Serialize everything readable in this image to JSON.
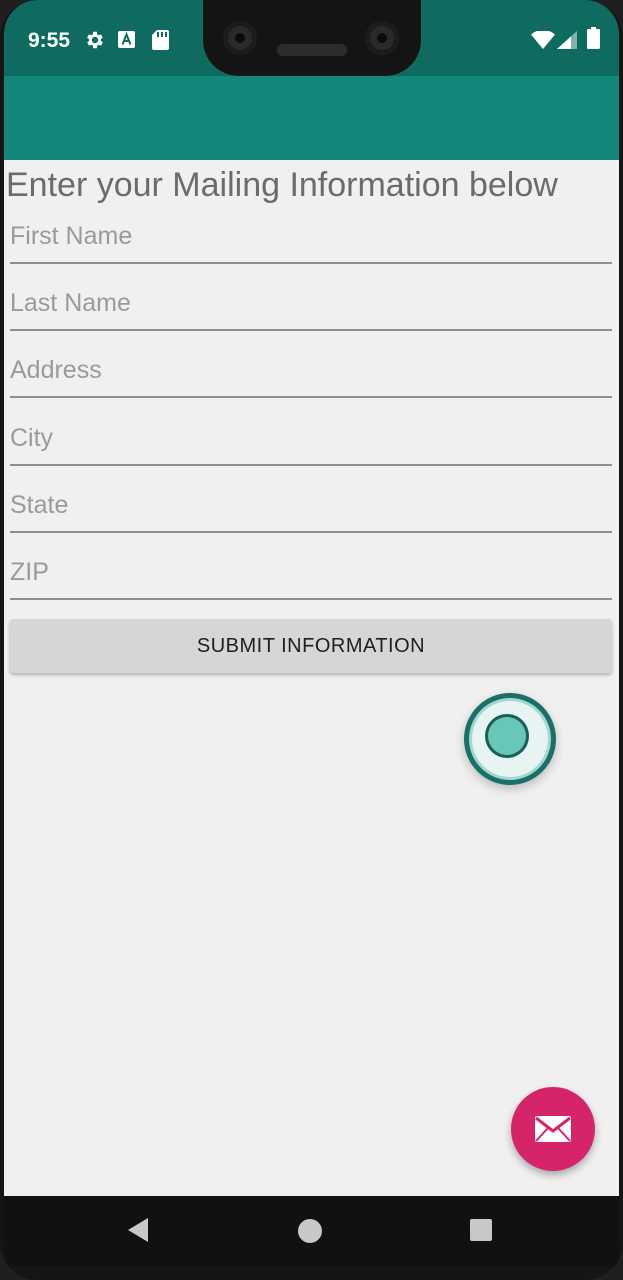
{
  "status_bar": {
    "time": "9:55",
    "icons": [
      "settings-gear-icon",
      "a-badge-icon",
      "sd-card-icon",
      "wifi-icon",
      "signal-icon",
      "battery-icon"
    ]
  },
  "form": {
    "heading": "Enter your Mailing Information below",
    "fields": [
      {
        "name": "first-name",
        "placeholder": "First Name"
      },
      {
        "name": "last-name",
        "placeholder": "Last Name"
      },
      {
        "name": "address",
        "placeholder": "Address"
      },
      {
        "name": "city",
        "placeholder": "City"
      },
      {
        "name": "state",
        "placeholder": "State"
      },
      {
        "name": "zip",
        "placeholder": "ZIP"
      }
    ],
    "submit_label": "SUBMIT INFORMATION"
  },
  "fab": {
    "icon": "mail-icon"
  },
  "nav": {
    "icons": [
      "back-icon",
      "home-icon",
      "recents-icon"
    ]
  },
  "colors": {
    "status_bar": "#0f6b60",
    "app_bar": "#12877a",
    "fab": "#d6246a",
    "background": "#f0f0f0"
  }
}
